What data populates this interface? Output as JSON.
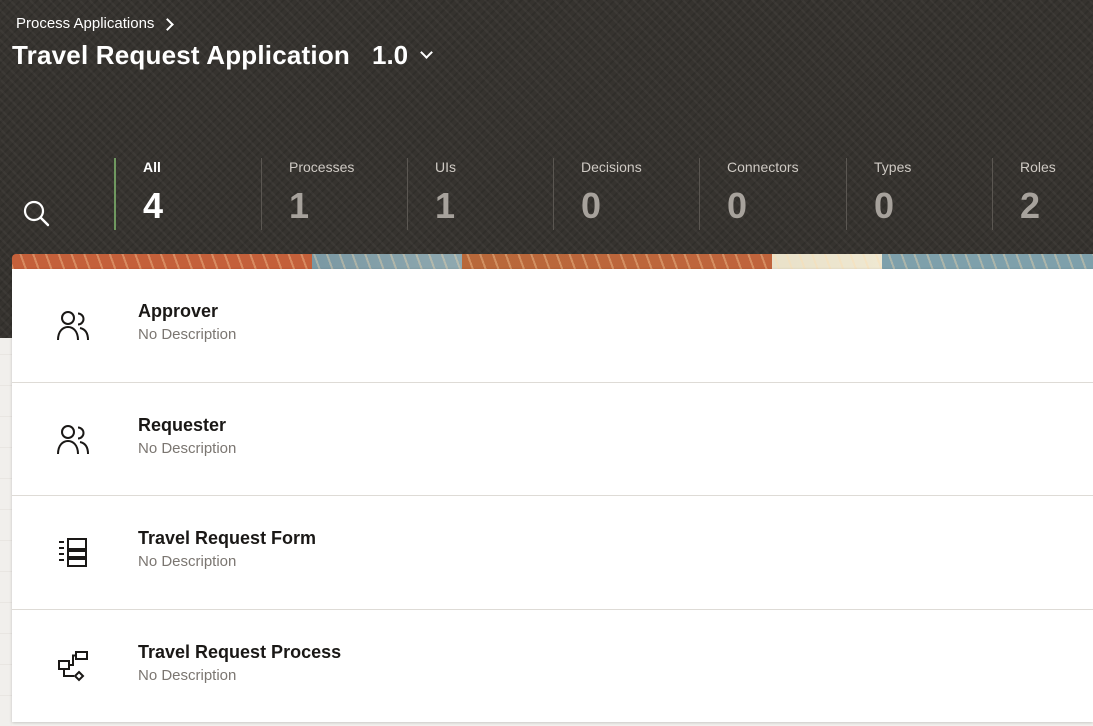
{
  "breadcrumb": {
    "label": "Process Applications"
  },
  "app": {
    "title": "Travel Request Application",
    "version": "1.0"
  },
  "stats": [
    {
      "label": "All",
      "count": "4"
    },
    {
      "label": "Processes",
      "count": "1"
    },
    {
      "label": "UIs",
      "count": "1"
    },
    {
      "label": "Decisions",
      "count": "0"
    },
    {
      "label": "Connectors",
      "count": "0"
    },
    {
      "label": "Types",
      "count": "0"
    },
    {
      "label": "Roles",
      "count": "2"
    }
  ],
  "items": [
    {
      "title": "Approver",
      "description": "No Description",
      "icon": "users-icon"
    },
    {
      "title": "Requester",
      "description": "No Description",
      "icon": "users-icon"
    },
    {
      "title": "Travel Request Form",
      "description": "No Description",
      "icon": "form-icon"
    },
    {
      "title": "Travel Request Process",
      "description": "No Description",
      "icon": "process-icon"
    }
  ],
  "colors": {
    "header_bg": "#36332f",
    "active_tab_accent": "#6f9960",
    "text_dark": "#1a1816",
    "muted": "#7b7671"
  }
}
